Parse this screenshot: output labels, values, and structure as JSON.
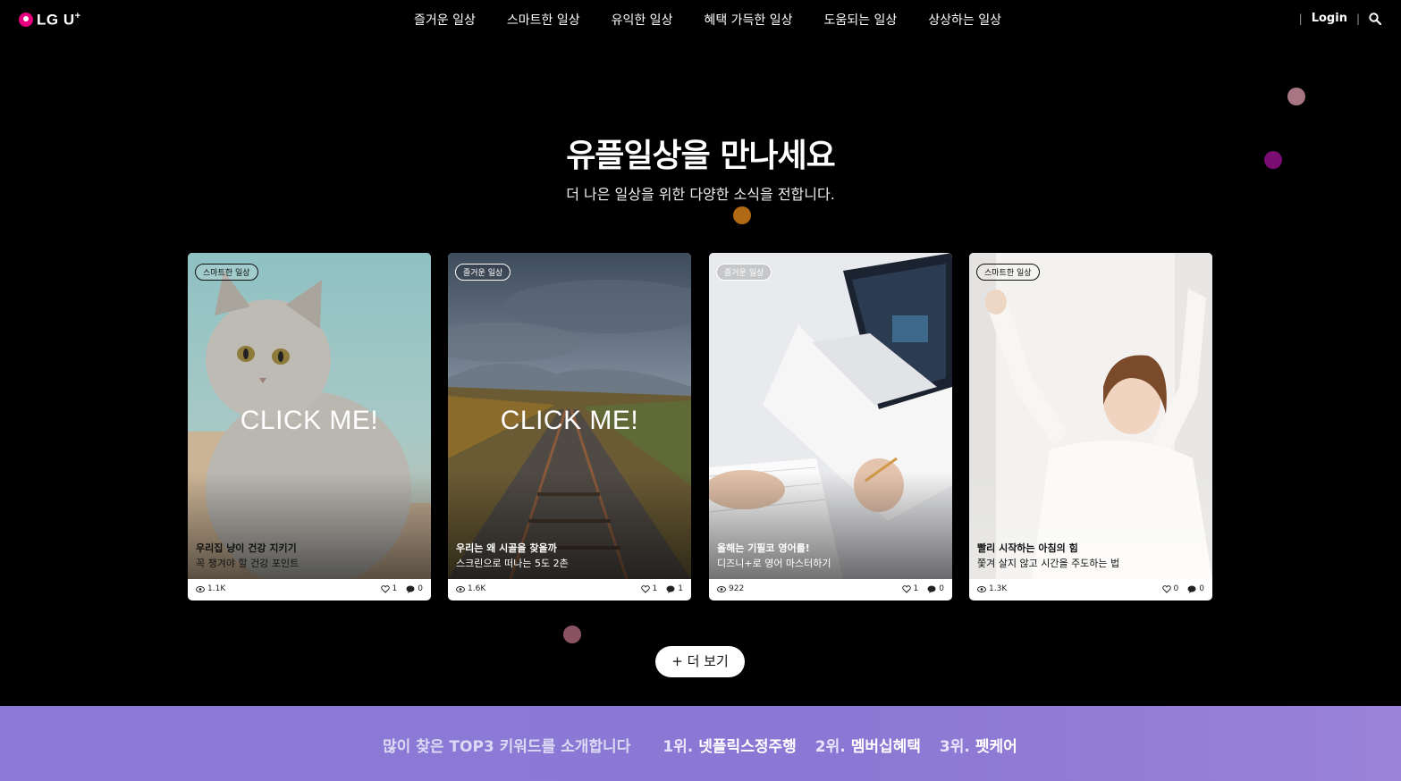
{
  "header": {
    "logo_text": "LG U",
    "logo_sup": "+",
    "nav": [
      "즐거운 일상",
      "스마트한 일상",
      "유익한 일상",
      "혜택 가득한 일상",
      "도움되는 일상",
      "상상하는 일상"
    ],
    "separator": "|",
    "login_label": "Login",
    "search_icon": "search-icon"
  },
  "hero": {
    "title": "유플일상을 만나세요",
    "subtitle": "더 나은 일상을 위한 다양한 소식을 전합니다."
  },
  "cards": [
    {
      "badge": "스마트한 일상",
      "overlay": "CLICK ME!",
      "title": "우리집 냥이 건강 지키기",
      "desc": "꼭 챙겨야 할 건강 포인트",
      "views": "1.1K",
      "likes": "1",
      "comments": "0"
    },
    {
      "badge": "즐거운 일상",
      "overlay": "CLICK ME!",
      "title": "우리는 왜 시골을 찾을까",
      "desc": "스크린으로 떠나는 5도 2촌",
      "views": "1.6K",
      "likes": "1",
      "comments": "1"
    },
    {
      "badge": "즐거운 일상",
      "overlay": "",
      "title": "올해는 기필코 영어를!",
      "desc": "디즈니+로 영어 마스터하기",
      "views": "922",
      "likes": "1",
      "comments": "0"
    },
    {
      "badge": "스마트한 일상",
      "overlay": "",
      "title": "빨리 시작하는 아침의 힘",
      "desc": "쫓겨 살지 않고 시간을 주도하는 법",
      "views": "1.3K",
      "likes": "0",
      "comments": "0"
    }
  ],
  "more_button": "+ 더 보기",
  "keywords": {
    "intro": "많이 찾은 TOP3 키워드를 소개합니다",
    "items": [
      {
        "rank": "1위.",
        "word": "넷플릭스정주행"
      },
      {
        "rank": "2위.",
        "word": "멤버십혜택"
      },
      {
        "rank": "3위.",
        "word": "펫케어"
      }
    ]
  },
  "colors": {
    "background": "#000000",
    "keyword_bar": "#8b7bd6",
    "logo_accent": "#e6007e"
  }
}
